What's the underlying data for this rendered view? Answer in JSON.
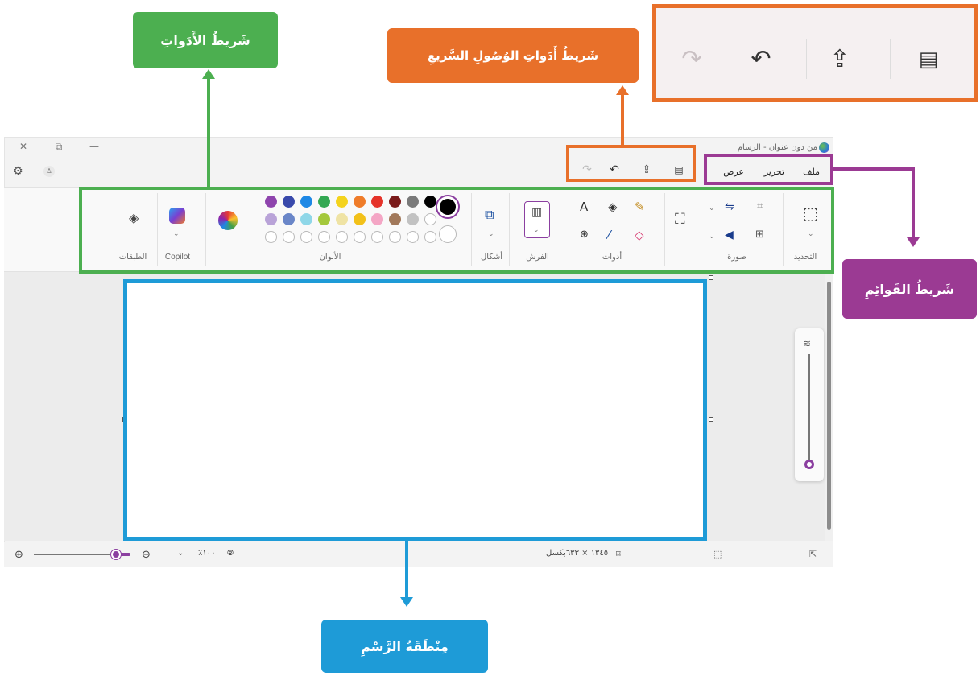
{
  "window": {
    "title": "من دون عنوان - الرسام",
    "controls": {
      "minimize": "—",
      "restore": "⧉",
      "close": "✕"
    }
  },
  "quick_access": {
    "save_icon": "💾",
    "share_icon": "⇪",
    "undo_icon": "↶",
    "redo_icon": "↷"
  },
  "menubar": {
    "file": "ملف",
    "edit": "تحرير",
    "view": "عرض"
  },
  "ribbon": {
    "groups": {
      "selection": "التحديد",
      "image": "صورة",
      "tools": "أدوات",
      "brushes": "الفرش",
      "shapes": "أشكال",
      "colors": "الألوان",
      "copilot": "Copilot",
      "layers": "الطبقات"
    },
    "colors_row1": [
      "#000000",
      "#7a7a7a",
      "#7a1a1a",
      "#e5332a",
      "#ef7c2a",
      "#f4d31d",
      "#34a853",
      "#1e88e5",
      "#3949ab",
      "#8e44ad"
    ],
    "colors_row2": [
      "#ffffff",
      "#c2c2c2",
      "#a1785a",
      "#f4a6c5",
      "#f2c11a",
      "#efe3a4",
      "#a4c83c",
      "#8fd7e8",
      "#6a86c8",
      "#b9a3d8"
    ],
    "colors_row3_count": 10,
    "primary_color": "#000000",
    "secondary_color": "#ffffff"
  },
  "status": {
    "zoom_percent": "٪١٠٠",
    "canvas_size": "١٣٤٥ × ٦٣٣بكسل"
  },
  "annotations": {
    "toolbar_label": "شَريطُ الأَدَواتِ",
    "quick_access_label": "شَريطُ أَدَواتِ الوُصُولِ السَّريعِ",
    "menu_label": "شَريطُ القَوائِمِ",
    "canvas_label": "مِنْطَقَةُ الرَّسْمِ",
    "colors": {
      "toolbar": "#4caf50",
      "quick_access": "#e8702a",
      "menu": "#9b3a93",
      "canvas": "#1e9bd7"
    }
  }
}
